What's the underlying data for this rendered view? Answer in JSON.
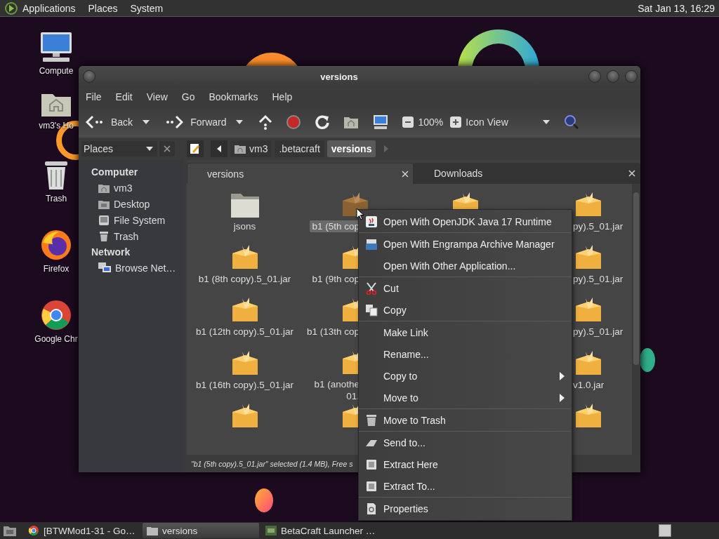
{
  "top_panel": {
    "menus": [
      "Applications",
      "Places",
      "System"
    ],
    "clock": "Sat Jan 13, 16:29"
  },
  "desktop_icons": [
    {
      "label": "Compute"
    },
    {
      "label": "vm3's Ho"
    },
    {
      "label": "Trash"
    },
    {
      "label": "Firefox"
    },
    {
      "label": "Google Chr"
    }
  ],
  "window": {
    "title": "versions",
    "menu": [
      "File",
      "Edit",
      "View",
      "Go",
      "Bookmarks",
      "Help"
    ],
    "toolbar": {
      "back": "Back",
      "forward": "Forward",
      "zoom": "100%",
      "view": "Icon View"
    },
    "side_pane": {
      "selector": "Places",
      "sections": [
        {
          "heading": "Computer",
          "items": [
            "vm3",
            "Desktop",
            "File System",
            "Trash"
          ]
        },
        {
          "heading": "Network",
          "items": [
            "Browse Net…"
          ]
        }
      ]
    },
    "path_bar": [
      {
        "label": "vm3",
        "selected": false
      },
      {
        "label": ".betacraft",
        "selected": false
      },
      {
        "label": "versions",
        "selected": true
      }
    ],
    "tabs": [
      {
        "label": "versions",
        "selected": true
      },
      {
        "label": "Downloads",
        "selected": false
      }
    ],
    "file_columns": [
      [
        {
          "name": "jsons",
          "kind": "folder",
          "selected": false
        },
        {
          "name": "b1 (8th copy).5_01.jar",
          "kind": "archive",
          "selected": false
        },
        {
          "name": "b1 (12th copy).5_01.jar",
          "kind": "archive",
          "selected": false
        },
        {
          "name": "b1 (16th copy).5_01.jar",
          "kind": "archive",
          "selected": false
        },
        {
          "kind": "archive",
          "selected": false
        }
      ],
      [
        {
          "name": "b1 (5th cop",
          "kind": "archive",
          "selected": true
        },
        {
          "name": "b1 (9th cop",
          "kind": "archive",
          "selected": false
        },
        {
          "name": "b1 (13th cop",
          "kind": "archive",
          "selected": false
        },
        {
          "name": "b1 (anothe\n01.",
          "kind": "archive",
          "selected": false
        },
        {
          "kind": "archive",
          "selected": false
        }
      ],
      [
        {
          "kind": "archive",
          "selected": false
        }
      ],
      [
        {
          "name": "py).5_01.jar",
          "kind": "archive",
          "selected": false
        },
        {
          "name": "py).5_01.jar",
          "kind": "archive",
          "selected": false
        },
        {
          "name": "py).5_01.jar",
          "kind": "archive",
          "selected": false
        },
        {
          "name": "v1.0.jar",
          "kind": "archive",
          "selected": false
        },
        {
          "kind": "archive",
          "selected": false
        }
      ]
    ],
    "status": "\"b1 (5th copy).5_01.jar\" selected (1.4 MB), Free s"
  },
  "context_menu": [
    [
      {
        "label": "Open With OpenJDK Java 17 Runtime",
        "submenu": false
      }
    ],
    [
      {
        "label": "Open With Engrampa Archive Manager",
        "submenu": false
      },
      {
        "label": "Open With Other Application...",
        "submenu": false
      }
    ],
    [
      {
        "label": "Cut",
        "submenu": false
      },
      {
        "label": "Copy",
        "submenu": false
      }
    ],
    [
      {
        "label": "Make Link",
        "submenu": false
      },
      {
        "label": "Rename...",
        "submenu": false
      },
      {
        "label": "Copy to",
        "submenu": true
      },
      {
        "label": "Move to",
        "submenu": true
      }
    ],
    [
      {
        "label": "Move to Trash",
        "submenu": false
      }
    ],
    [
      {
        "label": "Send to...",
        "submenu": false
      },
      {
        "label": "Extract Here",
        "submenu": false
      },
      {
        "label": "Extract To...",
        "submenu": false
      }
    ],
    [
      {
        "label": "Properties",
        "submenu": false
      }
    ]
  ],
  "taskbar": [
    {
      "label": "[BTWMod1-31 - Go…",
      "selected": false
    },
    {
      "label": "versions",
      "selected": true
    },
    {
      "label": "BetaCraft Launcher …",
      "selected": false
    }
  ]
}
